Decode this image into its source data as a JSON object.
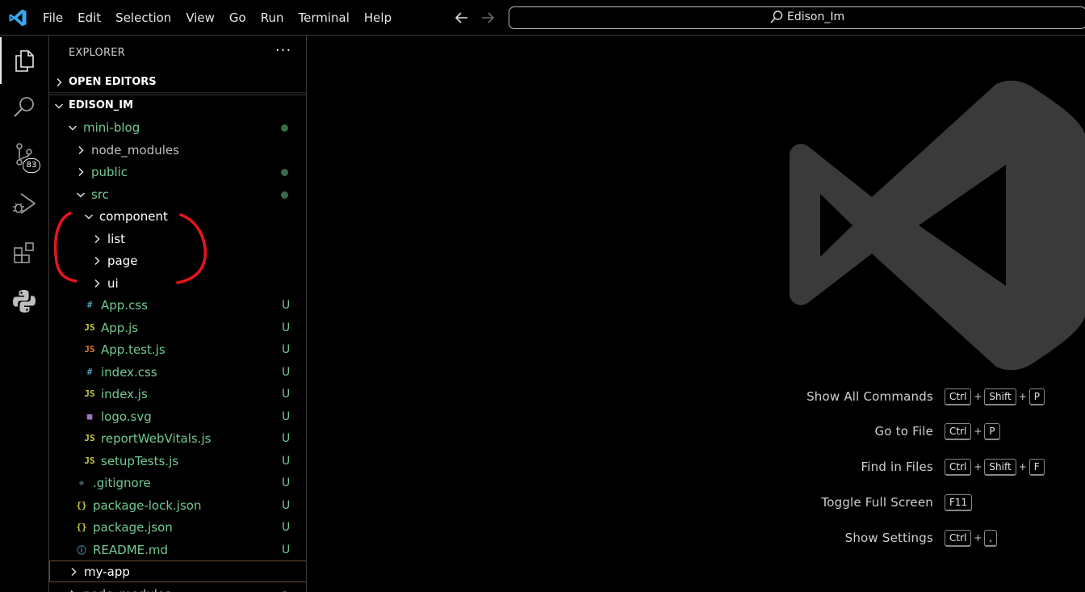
{
  "titlebar": {
    "menu": [
      "File",
      "Edit",
      "Selection",
      "View",
      "Go",
      "Run",
      "Terminal",
      "Help"
    ],
    "search_text": "Edison_Im"
  },
  "activitybar": {
    "items": [
      {
        "name": "explorer",
        "icon": "files-icon"
      },
      {
        "name": "search",
        "icon": "search-icon"
      },
      {
        "name": "source-control",
        "icon": "source-control-icon",
        "badge": "83"
      },
      {
        "name": "run-debug",
        "icon": "run-debug-icon"
      },
      {
        "name": "extensions",
        "icon": "extensions-icon"
      },
      {
        "name": "python",
        "icon": "python-icon"
      }
    ]
  },
  "sidebar": {
    "title": "EXPLORER",
    "more": "···",
    "open_editors": "OPEN EDITORS",
    "project": "EDISON_IM",
    "tree": [
      {
        "label": "mini-blog",
        "type": "folder-open",
        "depth": 1,
        "color": "green",
        "status": "dot"
      },
      {
        "label": "node_modules",
        "type": "folder",
        "depth": 2,
        "color": "gray"
      },
      {
        "label": "public",
        "type": "folder",
        "depth": 2,
        "color": "green",
        "status": "dot"
      },
      {
        "label": "src",
        "type": "folder-open",
        "depth": 2,
        "color": "green",
        "status": "dot"
      },
      {
        "label": "component",
        "type": "folder-open",
        "depth": 3,
        "color": "white"
      },
      {
        "label": "list",
        "type": "folder",
        "depth": 4,
        "color": "white"
      },
      {
        "label": "page",
        "type": "folder",
        "depth": 4,
        "color": "white"
      },
      {
        "label": "ui",
        "type": "folder",
        "depth": 4,
        "color": "white"
      },
      {
        "label": "App.css",
        "type": "css",
        "depth": 3,
        "color": "green",
        "status": "U"
      },
      {
        "label": "App.js",
        "type": "js",
        "depth": 3,
        "color": "green",
        "status": "U"
      },
      {
        "label": "App.test.js",
        "type": "jstest",
        "depth": 3,
        "color": "green",
        "status": "U"
      },
      {
        "label": "index.css",
        "type": "css",
        "depth": 3,
        "color": "green",
        "status": "U"
      },
      {
        "label": "index.js",
        "type": "js",
        "depth": 3,
        "color": "green",
        "status": "U"
      },
      {
        "label": "logo.svg",
        "type": "svg",
        "depth": 3,
        "color": "green",
        "status": "U"
      },
      {
        "label": "reportWebVitals.js",
        "type": "js",
        "depth": 3,
        "color": "green",
        "status": "U"
      },
      {
        "label": "setupTests.js",
        "type": "js",
        "depth": 3,
        "color": "green",
        "status": "U"
      },
      {
        "label": ".gitignore",
        "type": "git",
        "depth": 2,
        "color": "green",
        "status": "U"
      },
      {
        "label": "package-lock.json",
        "type": "json",
        "depth": 2,
        "color": "green",
        "status": "U"
      },
      {
        "label": "package.json",
        "type": "json",
        "depth": 2,
        "color": "green",
        "status": "U"
      },
      {
        "label": "README.md",
        "type": "info",
        "depth": 2,
        "color": "green",
        "status": "U"
      },
      {
        "label": "my-app",
        "type": "folder",
        "depth": 1,
        "color": "white",
        "focused": true
      },
      {
        "label": "node_modules",
        "type": "folder",
        "depth": 1,
        "color": "gray",
        "status": "dot"
      }
    ]
  },
  "welcome": {
    "shortcuts": [
      {
        "label": "Show All Commands",
        "keys": [
          "Ctrl",
          "Shift",
          "P"
        ]
      },
      {
        "label": "Go to File",
        "keys": [
          "Ctrl",
          "P"
        ]
      },
      {
        "label": "Find in Files",
        "keys": [
          "Ctrl",
          "Shift",
          "F"
        ]
      },
      {
        "label": "Toggle Full Screen",
        "keys": [
          "F11"
        ]
      },
      {
        "label": "Show Settings",
        "keys": [
          "Ctrl",
          ","
        ]
      }
    ]
  },
  "colors": {
    "accent_logo": "#3aa6f0",
    "git_untracked": "#73c991",
    "annotation": "#e8141c"
  }
}
